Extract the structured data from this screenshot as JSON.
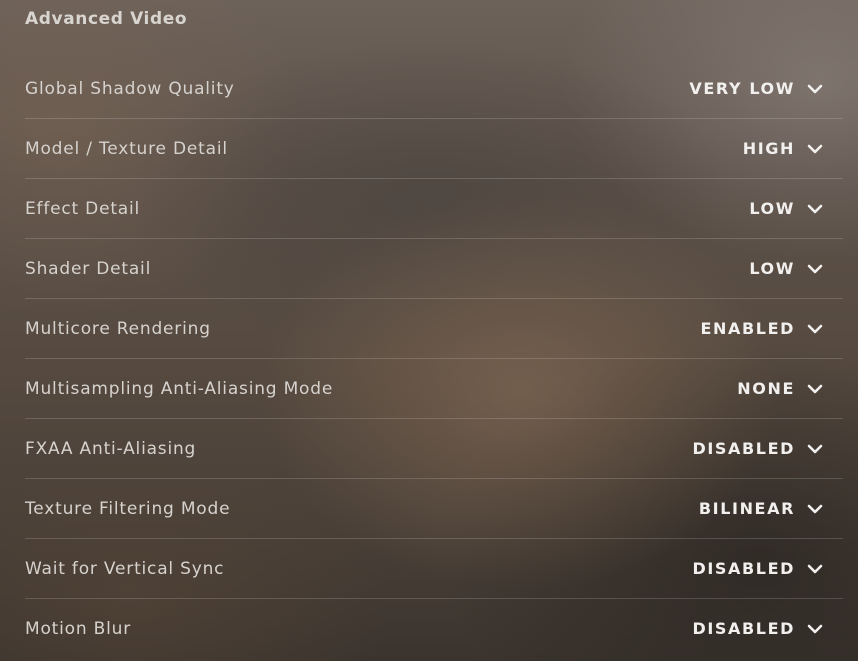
{
  "section": {
    "title": "Advanced Video"
  },
  "settings": [
    {
      "label": "Global Shadow Quality",
      "value": "VERY LOW",
      "icon": "chevron-down-icon"
    },
    {
      "label": "Model / Texture Detail",
      "value": "HIGH",
      "icon": "chevron-down-icon"
    },
    {
      "label": "Effect Detail",
      "value": "LOW",
      "icon": "chevron-down-icon"
    },
    {
      "label": "Shader Detail",
      "value": "LOW",
      "icon": "chevron-down-icon"
    },
    {
      "label": "Multicore Rendering",
      "value": "ENABLED",
      "icon": "chevron-down-icon"
    },
    {
      "label": "Multisampling Anti-Aliasing Mode",
      "value": "NONE",
      "icon": "chevron-down-icon"
    },
    {
      "label": "FXAA Anti-Aliasing",
      "value": "DISABLED",
      "icon": "chevron-down-icon"
    },
    {
      "label": "Texture Filtering Mode",
      "value": "BILINEAR",
      "icon": "chevron-down-icon"
    },
    {
      "label": "Wait for Vertical Sync",
      "value": "DISABLED",
      "icon": "chevron-down-icon"
    },
    {
      "label": "Motion Blur",
      "value": "DISABLED",
      "icon": "chevron-down-icon"
    }
  ],
  "colors": {
    "label": "#d6d2ce",
    "value": "#f2f0ee",
    "divider": "rgba(255,255,255,0.16)"
  }
}
